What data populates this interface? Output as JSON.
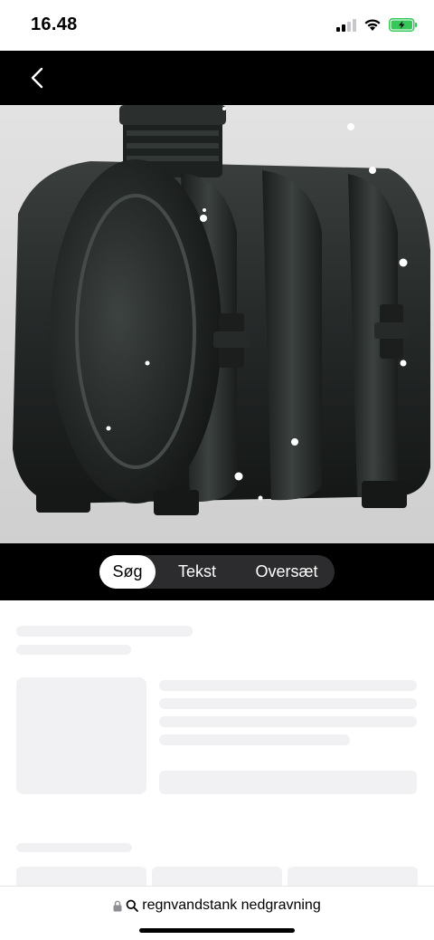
{
  "status_bar": {
    "time": "16.48"
  },
  "nav": {
    "back_icon": "chevron-left-icon"
  },
  "image": {
    "subject": "black plastic rainwater tank"
  },
  "segments": [
    {
      "label": "Søg",
      "active": true
    },
    {
      "label": "Tekst",
      "active": false
    },
    {
      "label": "Oversæt",
      "active": false
    }
  ],
  "address_bar": {
    "lock_icon": "lock-icon",
    "search_icon": "search-icon",
    "query": "regnvandstank nedgravning"
  },
  "colors": {
    "nav_bg": "#000000",
    "segment_bg": "#2c2c2e",
    "segment_active": "#ffffff",
    "skeleton": "#f1f1f3",
    "battery": "#34c759"
  }
}
